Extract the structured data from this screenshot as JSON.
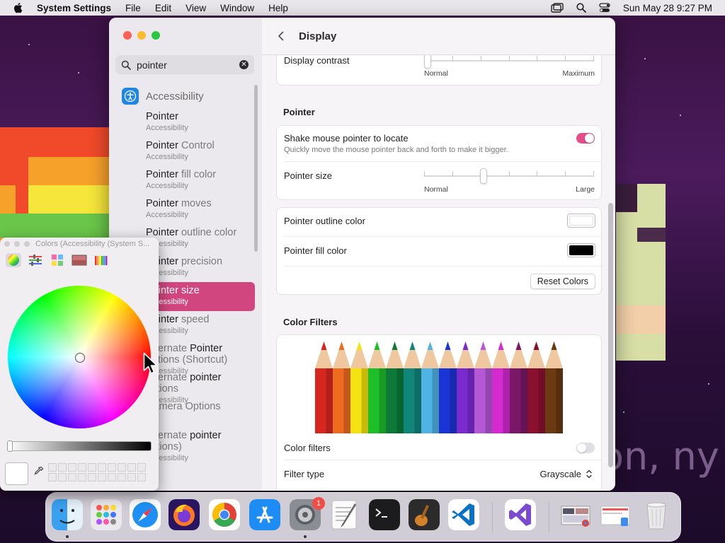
{
  "menubar": {
    "app": "System Settings",
    "menus": [
      "File",
      "Edit",
      "View",
      "Window",
      "Help"
    ],
    "clock": "Sun May 28  9:27 PM"
  },
  "window": {
    "title": "Display",
    "search": {
      "value": "pointer"
    },
    "sidebar": {
      "section": "Accessibility",
      "items": [
        {
          "title_pre": "",
          "title_bold": "Pointer",
          "title_post": "",
          "sub": "Accessibility"
        },
        {
          "title_pre": "",
          "title_bold": "Pointer",
          "title_post": " Control",
          "sub": "Accessibility"
        },
        {
          "title_pre": "",
          "title_bold": "Pointer",
          "title_post": " fill color",
          "sub": "Accessibility"
        },
        {
          "title_pre": "",
          "title_bold": "Pointer",
          "title_post": " moves",
          "sub": "Accessibility"
        },
        {
          "title_pre": "",
          "title_bold": "Pointer",
          "title_post": " outline color",
          "sub": "Accessibility"
        },
        {
          "title_pre": "",
          "title_bold": "Pointer",
          "title_post": " precision",
          "sub": "Accessibility"
        },
        {
          "title_pre": "",
          "title_bold": "Pointer",
          "title_post": " size",
          "sub": "Accessibility"
        },
        {
          "title_pre": "",
          "title_bold": "Pointer",
          "title_post": " speed",
          "sub": "Accessibility"
        },
        {
          "title_pre": "Alternate ",
          "title_bold": "Pointer",
          "title_post": " Actions (Shortcut)",
          "sub": "Accessibility"
        },
        {
          "title_pre": "Alternate ",
          "title_bold": "pointer",
          "title_post": " actions",
          "sub": "Accessibility"
        },
        {
          "title_pre": "Camera Options",
          "title_bold": "",
          "title_post": "",
          "sub": ""
        },
        {
          "title_pre": "Alternate ",
          "title_bold": "pointer",
          "title_post": " actions)",
          "sub": "Accessibility"
        }
      ]
    },
    "display_contrast": {
      "label": "Display contrast",
      "min_label": "Normal",
      "max_label": "Maximum",
      "value": 0
    },
    "pointer": {
      "heading": "Pointer",
      "shake": {
        "label": "Shake mouse pointer to locate",
        "desc": "Quickly move the mouse pointer back and forth to make it bigger.",
        "on": true
      },
      "size": {
        "label": "Pointer size",
        "min_label": "Normal",
        "max_label": "Large",
        "value": 0.34
      },
      "outline": {
        "label": "Pointer outline color",
        "color": "#ffffff"
      },
      "fill": {
        "label": "Pointer fill color",
        "color": "#000000"
      },
      "reset_label": "Reset Colors"
    },
    "color_filters": {
      "heading": "Color Filters",
      "toggle_label": "Color filters",
      "on": false,
      "type_label": "Filter type",
      "type_value": "Grayscale",
      "pencils": [
        "#d7261e",
        "#ef6b20",
        "#f5e211",
        "#1fbf2a",
        "#0d7a3a",
        "#11857a",
        "#4fb3e4",
        "#1b34d6",
        "#7a2bd0",
        "#b558d6",
        "#d42ad0",
        "#7a1868",
        "#8a1030",
        "#6b3a12"
      ]
    }
  },
  "colors_panel": {
    "title": "Colors (Accessibility (System S..."
  },
  "dock": {
    "settings_badge": "1"
  },
  "colors": {
    "accent": "#d2467f",
    "toggle_on": "#e64d8b"
  }
}
